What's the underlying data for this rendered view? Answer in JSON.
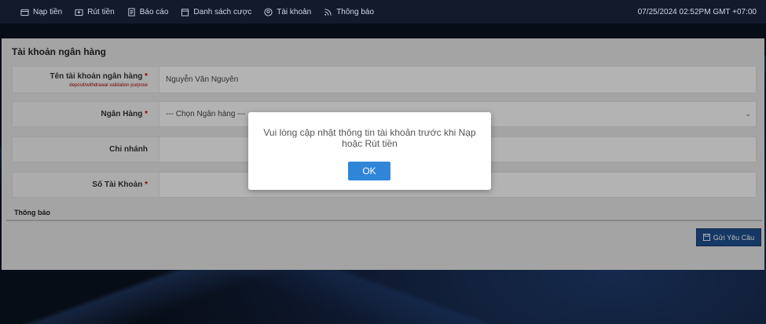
{
  "nav": {
    "items": [
      {
        "label": "Nạp tiền",
        "icon": "wallet-icon"
      },
      {
        "label": "Rút tiền",
        "icon": "withdraw-icon"
      },
      {
        "label": "Báo cáo",
        "icon": "report-icon"
      },
      {
        "label": "Danh sách cược",
        "icon": "calendar-icon"
      },
      {
        "label": "Tài khoản",
        "icon": "account-icon"
      },
      {
        "label": "Thông báo",
        "icon": "rss-icon"
      }
    ],
    "clock": "07/25/2024 02:52PM GMT +07:00"
  },
  "form": {
    "title": "Tài khoản ngân hàng",
    "account_name": {
      "label": "Tên tài khoản ngân hàng",
      "required": "*",
      "sub": "deposit/withdrawal validation purpose",
      "value": "Nguyễn Văn Nguyên"
    },
    "bank": {
      "label": "Ngân Hàng",
      "required": "*",
      "value": "--- Chọn Ngân hàng ---"
    },
    "branch": {
      "label": "Chi nhánh",
      "value": ""
    },
    "account_number": {
      "label": "Số Tài Khoản",
      "required": "*",
      "value": ""
    },
    "notice_label": "Thông báo",
    "submit_label": "Gửi Yêu Cầu"
  },
  "modal": {
    "message": "Vui lòng cập nhật thông tin tài khoản trước khi Nạp hoặc Rút tiền",
    "ok_label": "OK"
  }
}
